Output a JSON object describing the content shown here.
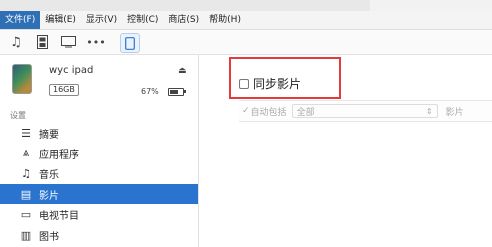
{
  "menubar": {
    "items": [
      "文件(F)",
      "编辑(E)",
      "显示(V)",
      "控制(C)",
      "商店(S)",
      "帮助(H)"
    ]
  },
  "toolbar": {
    "icons": [
      "music-note-icon",
      "film-icon",
      "tv-icon",
      "more-icon",
      "ipad-device-icon"
    ]
  },
  "device": {
    "name": "wyc ipad",
    "capacity": "16GB",
    "battery": "67%",
    "battery_level": 0.67
  },
  "sidebar": {
    "section_label": "设置",
    "items": [
      {
        "label": "摘要",
        "icon": "summary-icon",
        "glyph": "☰"
      },
      {
        "label": "应用程序",
        "icon": "apps-icon",
        "glyph": "⩓"
      },
      {
        "label": "音乐",
        "icon": "music-note-icon",
        "glyph": "♫"
      },
      {
        "label": "影片",
        "icon": "film-icon",
        "glyph": "▤"
      },
      {
        "label": "电视节目",
        "icon": "tv-icon",
        "glyph": "▭"
      },
      {
        "label": "图书",
        "icon": "book-icon",
        "glyph": "📖"
      }
    ],
    "selected_index": 3
  },
  "main": {
    "sync_label": "同步影片",
    "auto_include_label": "自动包括",
    "auto_include_value": "全部",
    "movies_label": "影片"
  },
  "colors": {
    "selection": "#2a74d0",
    "highlight_box": "#e33a3a"
  }
}
